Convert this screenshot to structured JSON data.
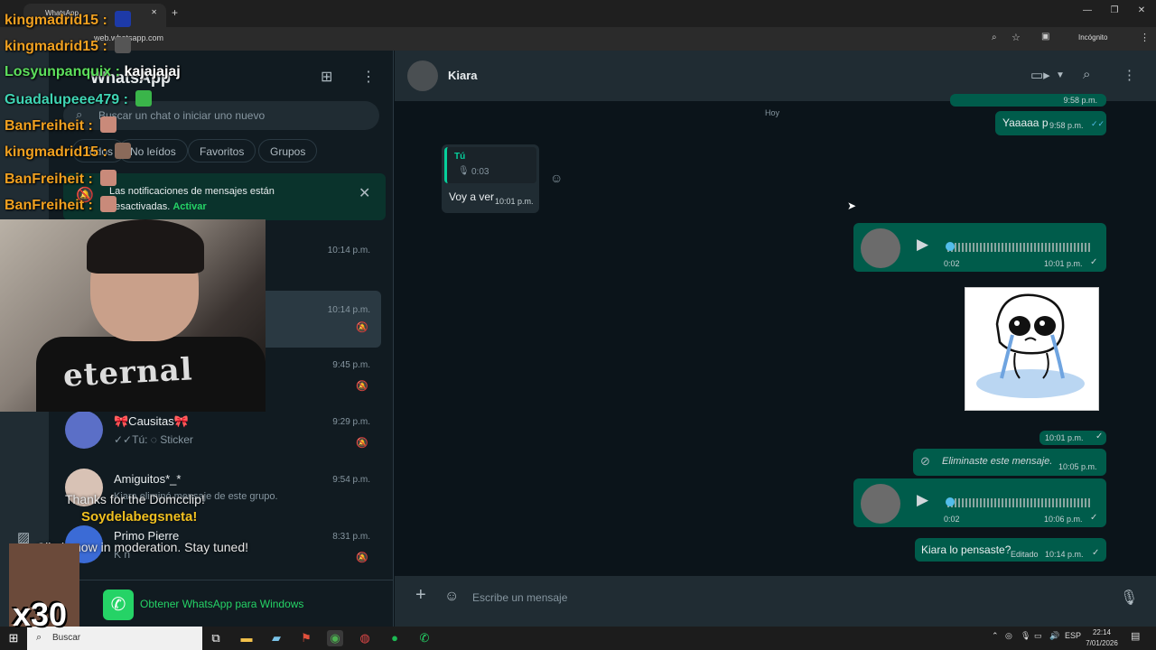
{
  "browser": {
    "tab_title": "WhatsApp",
    "url": "web.whatsapp.com",
    "incognito_label": "Incógnito"
  },
  "sidebar": {
    "app_title": "WhatsApp",
    "search_placeholder": "Buscar un chat o iniciar uno nuevo",
    "filters": [
      "Todos",
      "No leídos",
      "Favoritos",
      "Grupos"
    ],
    "notification": {
      "text": "Las notificaciones de mensajes están desactivadas.",
      "action": "Activar"
    },
    "chats": [
      {
        "name": "",
        "preview": "",
        "time": "10:14 p.m."
      },
      {
        "name": "",
        "preview": "",
        "time": "10:14 p.m."
      },
      {
        "name": "",
        "preview": "",
        "time": "9:45 p.m."
      },
      {
        "name": "🎀Causitas🎀",
        "preview": "✓✓Tú: ◌ Sticker",
        "time": "9:29 p.m."
      },
      {
        "name": "Amiguitos*_*",
        "preview": "Kiara eliminó mensaje de este grupo.",
        "time": "9:54 p.m."
      },
      {
        "name": "Primo Pierre",
        "preview": "K n",
        "time": "8:31 p.m."
      }
    ],
    "get_app_label": "Obtener WhatsApp para Windows"
  },
  "chat": {
    "contact_name": "Kiara",
    "day_label": "Hoy",
    "messages": {
      "partial_top_time": "9:58 p.m.",
      "m1_text": "Yaaaaa p",
      "m1_time": "9:58 p.m.",
      "reply_quote_author": "Tú",
      "reply_quote_duration": "0:03",
      "m2_text": "Voy a ver",
      "m2_time": "10:01 p.m.",
      "voice1_duration": "0:02",
      "voice1_time": "10:01 p.m.",
      "sticker_time": "10:01 p.m.",
      "deleted_text": "Eliminaste este mensaje.",
      "deleted_time": "10:05 p.m.",
      "voice2_duration": "0:02",
      "voice2_time": "10:06 p.m.",
      "last_text": "Kiara lo pensaste?",
      "last_edited": "Editado",
      "last_time": "10:14 p.m."
    },
    "composer_placeholder": "Escribe un mensaje"
  },
  "taskbar": {
    "search_label": "Buscar",
    "lang": "ESP",
    "time": "22:14",
    "date": "7/01/2026"
  },
  "stream_overlay": {
    "chat_lines": [
      {
        "user": "kingmadrid15",
        "msg": ""
      },
      {
        "user": "kingmadrid15",
        "msg": ""
      },
      {
        "user": "Losyunpanquix",
        "msg": "kajajajaj"
      },
      {
        "user": "Guadalupeee479",
        "msg": ""
      },
      {
        "user": "BanFreiheit",
        "msg": ""
      },
      {
        "user": "kingmadrid15",
        "msg": ""
      },
      {
        "user": "BanFreiheit",
        "msg": ""
      },
      {
        "user": "BanFreiheit",
        "msg": ""
      }
    ],
    "thanks_text": "Thanks for the Domcclip!",
    "thanks_user": "Soydelabegsneta!",
    "moderation_text": "Clip is now in moderation. Stay tuned!",
    "multiplier": "x30",
    "shirt_text": "eternal"
  }
}
